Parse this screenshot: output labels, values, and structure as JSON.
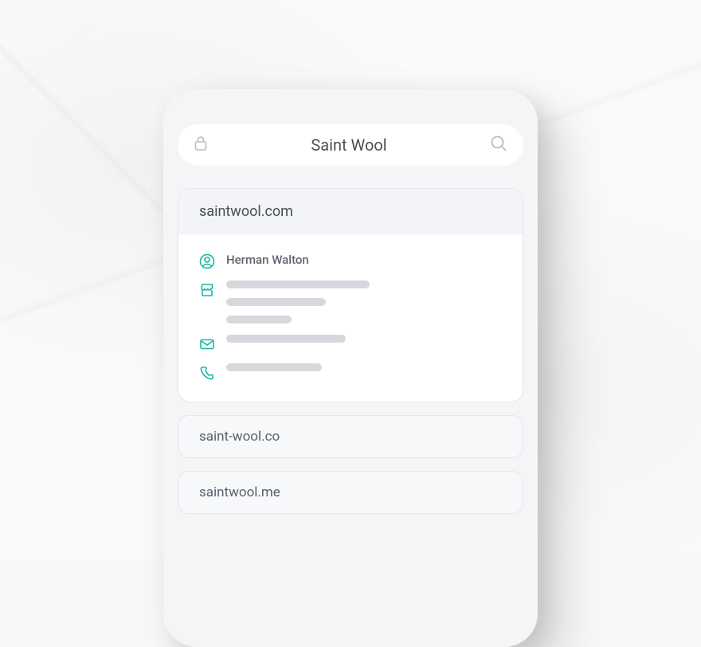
{
  "search": {
    "title": "Saint Wool"
  },
  "selectedDomain": {
    "domain": "saintwool.com",
    "contactName": "Herman Walton"
  },
  "altDomains": [
    "saint-wool.co",
    "saintwool.me"
  ]
}
